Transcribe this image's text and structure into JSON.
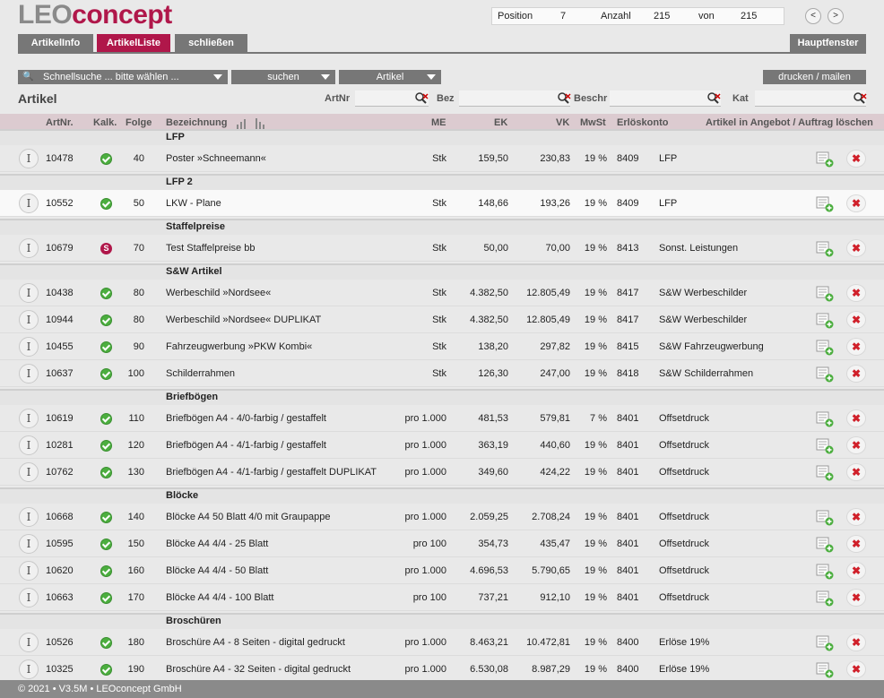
{
  "logo": {
    "part1": "LEO",
    "part2": "concept"
  },
  "position": {
    "label": "Position",
    "value": "7",
    "count_label": "Anzahl",
    "count": "215",
    "of_label": "von",
    "total": "215"
  },
  "nav": {
    "prev": "<",
    "next": ">"
  },
  "tabs": {
    "info": "ArtikelInfo",
    "list": "ArtikelListe",
    "close": "schließen",
    "main": "Hauptfenster"
  },
  "toolbar": {
    "quicksearch": "Schnellsuche ... bitte wählen ...",
    "search": "suchen",
    "type": "Artikel",
    "print": "drucken / mailen"
  },
  "page_title": "Artikel",
  "filters": {
    "artnr": "ArtNr",
    "bez": "Bez",
    "beschr": "Beschr",
    "kat": "Kat"
  },
  "columns": {
    "artnr": "ArtNr.",
    "kalk": "Kalk.",
    "folge": "Folge",
    "bez": "Bezeichnung",
    "me": "ME",
    "ek": "EK",
    "vk": "VK",
    "mwst": "MwSt",
    "konto": "Erlöskonto",
    "action": "Artikel in Angebot / Auftrag löschen"
  },
  "groups": [
    {
      "name": "LFP",
      "rows": [
        {
          "artnr": "10478",
          "kalk": "ok",
          "folge": "40",
          "bez": "Poster »Schneemann«",
          "me": "Stk",
          "ek": "159,50",
          "vk": "230,83",
          "mwst": "19 %",
          "konto": "8409",
          "kat": "LFP"
        }
      ]
    },
    {
      "name": "LFP 2",
      "rows": [
        {
          "artnr": "10552",
          "kalk": "ok",
          "folge": "50",
          "bez": "LKW - Plane",
          "me": "Stk",
          "ek": "148,66",
          "vk": "193,26",
          "mwst": "19 %",
          "konto": "8409",
          "kat": "LFP"
        }
      ]
    },
    {
      "name": "Staffelpreise",
      "rows": [
        {
          "artnr": "10679",
          "kalk": "S",
          "folge": "70",
          "bez": "Test Staffelpreise bb",
          "me": "Stk",
          "ek": "50,00",
          "vk": "70,00",
          "mwst": "19 %",
          "konto": "8413",
          "kat": "Sonst. Leistungen"
        }
      ]
    },
    {
      "name": "S&W Artikel",
      "rows": [
        {
          "artnr": "10438",
          "kalk": "ok",
          "folge": "80",
          "bez": "Werbeschild »Nordsee«",
          "me": "Stk",
          "ek": "4.382,50",
          "vk": "12.805,49",
          "mwst": "19 %",
          "konto": "8417",
          "kat": "S&W Werbeschilder"
        },
        {
          "artnr": "10944",
          "kalk": "ok",
          "folge": "80",
          "bez": "Werbeschild »Nordsee« DUPLIKAT",
          "me": "Stk",
          "ek": "4.382,50",
          "vk": "12.805,49",
          "mwst": "19 %",
          "konto": "8417",
          "kat": "S&W Werbeschilder"
        },
        {
          "artnr": "10455",
          "kalk": "ok",
          "folge": "90",
          "bez": "Fahrzeugwerbung »PKW Kombi«",
          "me": "Stk",
          "ek": "138,20",
          "vk": "297,82",
          "mwst": "19 %",
          "konto": "8415",
          "kat": "S&W Fahrzeugwerbung"
        },
        {
          "artnr": "10637",
          "kalk": "ok",
          "folge": "100",
          "bez": "Schilderrahmen",
          "me": "Stk",
          "ek": "126,30",
          "vk": "247,00",
          "mwst": "19 %",
          "konto": "8418",
          "kat": "S&W Schilderrahmen"
        }
      ]
    },
    {
      "name": "Briefbögen",
      "rows": [
        {
          "artnr": "10619",
          "kalk": "ok",
          "folge": "110",
          "bez": "Briefbögen A4 - 4/0-farbig / gestaffelt",
          "me": "pro 1.000",
          "ek": "481,53",
          "vk": "579,81",
          "mwst": "7 %",
          "konto": "8401",
          "kat": "Offsetdruck"
        },
        {
          "artnr": "10281",
          "kalk": "ok",
          "folge": "120",
          "bez": "Briefbögen A4 - 4/1-farbig / gestaffelt",
          "me": "pro 1.000",
          "ek": "363,19",
          "vk": "440,60",
          "mwst": "19 %",
          "konto": "8401",
          "kat": "Offsetdruck"
        },
        {
          "artnr": "10762",
          "kalk": "ok",
          "folge": "130",
          "bez": "Briefbögen A4 - 4/1-farbig / gestaffelt DUPLIKAT",
          "me": "pro 1.000",
          "ek": "349,60",
          "vk": "424,22",
          "mwst": "19 %",
          "konto": "8401",
          "kat": "Offsetdruck"
        }
      ]
    },
    {
      "name": "Blöcke",
      "rows": [
        {
          "artnr": "10668",
          "kalk": "ok",
          "folge": "140",
          "bez": "Blöcke A4 50 Blatt 4/0 mit Graupappe",
          "me": "pro 1.000",
          "ek": "2.059,25",
          "vk": "2.708,24",
          "mwst": "19 %",
          "konto": "8401",
          "kat": "Offsetdruck"
        },
        {
          "artnr": "10595",
          "kalk": "ok",
          "folge": "150",
          "bez": "Blöcke A4 4/4 - 25 Blatt",
          "me": "pro 100",
          "ek": "354,73",
          "vk": "435,47",
          "mwst": "19 %",
          "konto": "8401",
          "kat": "Offsetdruck"
        },
        {
          "artnr": "10620",
          "kalk": "ok",
          "folge": "160",
          "bez": "Blöcke A4 4/4 - 50 Blatt",
          "me": "pro 1.000",
          "ek": "4.696,53",
          "vk": "5.790,65",
          "mwst": "19 %",
          "konto": "8401",
          "kat": "Offsetdruck"
        },
        {
          "artnr": "10663",
          "kalk": "ok",
          "folge": "170",
          "bez": "Blöcke A4 4/4 - 100 Blatt",
          "me": "pro 100",
          "ek": "737,21",
          "vk": "912,10",
          "mwst": "19 %",
          "konto": "8401",
          "kat": "Offsetdruck"
        }
      ]
    },
    {
      "name": "Broschüren",
      "rows": [
        {
          "artnr": "10526",
          "kalk": "ok",
          "folge": "180",
          "bez": "Broschüre A4 - 8 Seiten - digital gedruckt",
          "me": "pro 1.000",
          "ek": "8.463,21",
          "vk": "10.472,81",
          "mwst": "19 %",
          "konto": "8400",
          "kat": "Erlöse 19%"
        },
        {
          "artnr": "10325",
          "kalk": "ok",
          "folge": "190",
          "bez": "Broschüre A4 - 32 Seiten - digital gedruckt",
          "me": "pro 1.000",
          "ek": "6.530,08",
          "vk": "8.987,29",
          "mwst": "19 %",
          "konto": "8400",
          "kat": "Erlöse 19%"
        }
      ]
    }
  ],
  "footer": "© 2021 • V3.5M • LEOconcept GmbH",
  "colors": {
    "accent": "#b0174a",
    "button": "#777777",
    "check": "#4cae3f",
    "delete": "#d0202a"
  }
}
